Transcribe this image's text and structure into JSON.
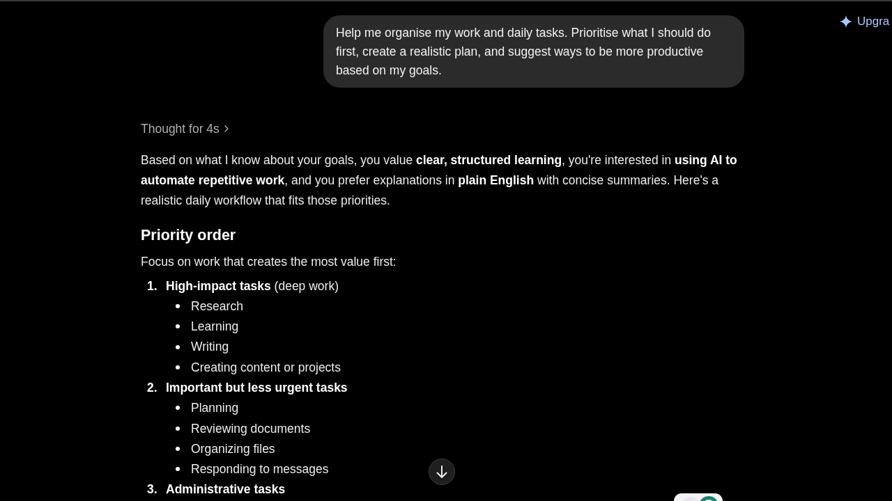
{
  "header": {
    "upgrade_label": "Upgra"
  },
  "conversation": {
    "user_message": "Help me organise my work and daily tasks. Prioritise what I should do first, create a realistic plan, and suggest ways to be more productive based on my goals.",
    "assistant": {
      "thought": {
        "label": "Thought for 4s",
        "expanded": false
      },
      "intro": "Based on what I know about your goals, you value **clear, structured learning**, you're interested in **using AI to automate repetitive work**, and you prefer explanations in **plain English** with concise summaries. Here's a realistic daily workflow that fits those priorities.",
      "sections": [
        {
          "heading": "Priority order",
          "lead": "Focus on work that creates the most value first:",
          "items": [
            {
              "marker": "1.",
              "title": "High-impact tasks",
              "note": "(deep work)",
              "children": [
                {
                  "text": "Research"
                },
                {
                  "text": "Learning"
                },
                {
                  "text": "Writing"
                },
                {
                  "text": "Creating content or projects"
                }
              ]
            },
            {
              "marker": "2.",
              "title": "Important but less urgent tasks",
              "children": [
                {
                  "text": "Planning"
                },
                {
                  "text": "Reviewing documents"
                },
                {
                  "text": "Organizing files"
                },
                {
                  "text": "Responding to messages"
                }
              ]
            },
            {
              "marker": "3.",
              "title": "Administrative tasks"
            }
          ]
        }
      ]
    }
  }
}
